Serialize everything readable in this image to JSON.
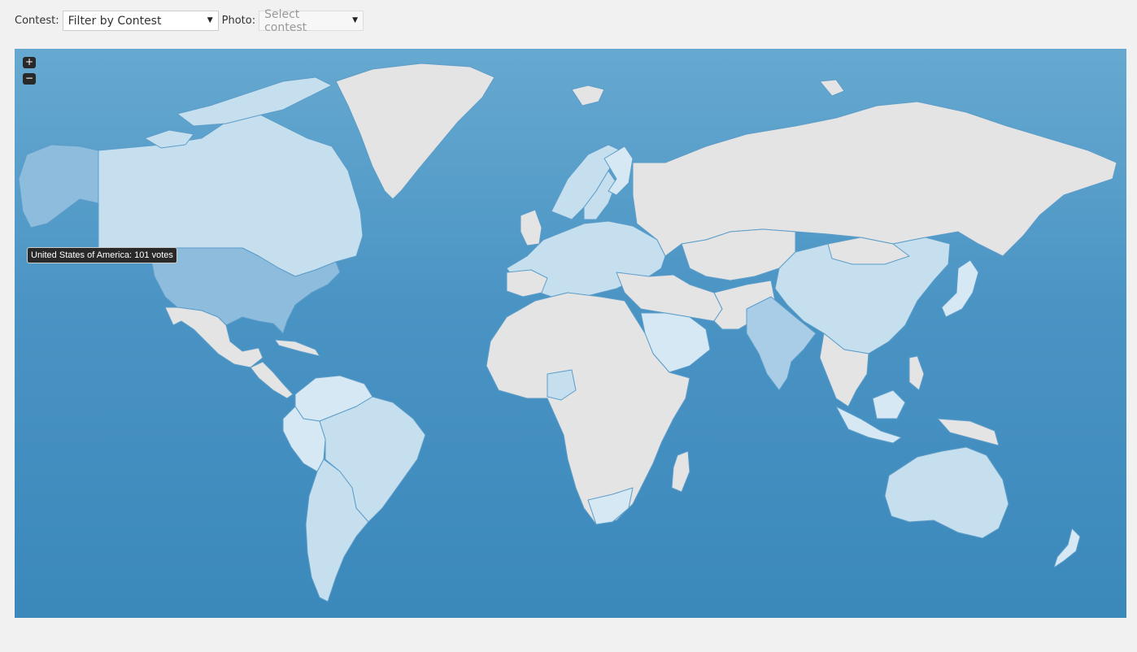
{
  "filters": {
    "contest_label": "Contest:",
    "contest_value": "Filter by Contest",
    "photo_label": "Photo:",
    "photo_placeholder": "Select contest"
  },
  "map": {
    "ocean_color": "#4a94c4",
    "zoom_in_label": "+",
    "zoom_out_label": "−",
    "tooltip_text": "United States of America: 101 votes",
    "legend_scale": {
      "none": "#e4e4e4",
      "low": "#d6e8f4",
      "medium": "#c5dfee",
      "high": "#a9cde6",
      "highest": "#8ebcdd"
    },
    "countries": [
      {
        "name": "United States of America",
        "level": "highest"
      },
      {
        "name": "Alaska",
        "level": "highest"
      },
      {
        "name": "Canada",
        "level": "medium"
      },
      {
        "name": "Greenland",
        "level": "none"
      },
      {
        "name": "Mexico",
        "level": "none"
      },
      {
        "name": "Brazil",
        "level": "medium"
      },
      {
        "name": "Argentina",
        "level": "medium"
      },
      {
        "name": "Peru",
        "level": "low"
      },
      {
        "name": "Colombia",
        "level": "low"
      },
      {
        "name": "Russia",
        "level": "none"
      },
      {
        "name": "China",
        "level": "medium"
      },
      {
        "name": "India",
        "level": "high"
      },
      {
        "name": "Australia",
        "level": "medium"
      },
      {
        "name": "Saudi Arabia",
        "level": "low"
      },
      {
        "name": "Nigeria",
        "level": "medium"
      },
      {
        "name": "South Africa",
        "level": "low"
      },
      {
        "name": "Norway",
        "level": "medium"
      },
      {
        "name": "Sweden",
        "level": "medium"
      },
      {
        "name": "Finland",
        "level": "low"
      },
      {
        "name": "Europe",
        "level": "medium"
      },
      {
        "name": "Japan",
        "level": "low"
      },
      {
        "name": "Indonesia",
        "level": "low"
      },
      {
        "name": "New Zealand",
        "level": "low"
      },
      {
        "name": "Africa",
        "level": "none"
      }
    ]
  }
}
